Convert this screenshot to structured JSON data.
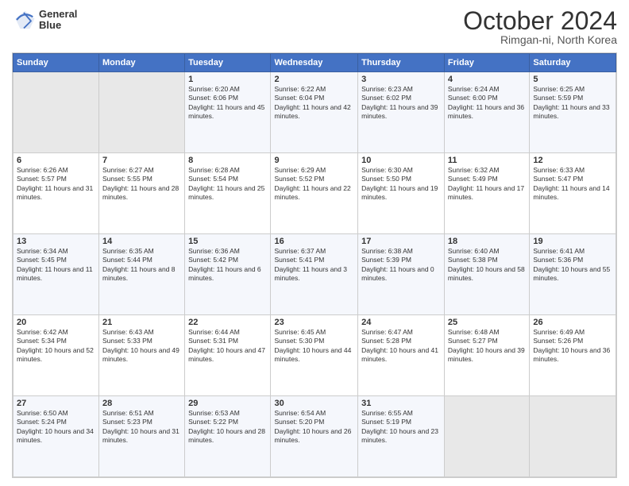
{
  "header": {
    "logo": {
      "line1": "General",
      "line2": "Blue"
    },
    "title": "October 2024",
    "subtitle": "Rimgan-ni, North Korea"
  },
  "weekdays": [
    "Sunday",
    "Monday",
    "Tuesday",
    "Wednesday",
    "Thursday",
    "Friday",
    "Saturday"
  ],
  "weeks": [
    [
      {
        "day": null,
        "sunrise": null,
        "sunset": null,
        "daylight": null
      },
      {
        "day": null,
        "sunrise": null,
        "sunset": null,
        "daylight": null
      },
      {
        "day": "1",
        "sunrise": "Sunrise: 6:20 AM",
        "sunset": "Sunset: 6:06 PM",
        "daylight": "Daylight: 11 hours and 45 minutes."
      },
      {
        "day": "2",
        "sunrise": "Sunrise: 6:22 AM",
        "sunset": "Sunset: 6:04 PM",
        "daylight": "Daylight: 11 hours and 42 minutes."
      },
      {
        "day": "3",
        "sunrise": "Sunrise: 6:23 AM",
        "sunset": "Sunset: 6:02 PM",
        "daylight": "Daylight: 11 hours and 39 minutes."
      },
      {
        "day": "4",
        "sunrise": "Sunrise: 6:24 AM",
        "sunset": "Sunset: 6:00 PM",
        "daylight": "Daylight: 11 hours and 36 minutes."
      },
      {
        "day": "5",
        "sunrise": "Sunrise: 6:25 AM",
        "sunset": "Sunset: 5:59 PM",
        "daylight": "Daylight: 11 hours and 33 minutes."
      }
    ],
    [
      {
        "day": "6",
        "sunrise": "Sunrise: 6:26 AM",
        "sunset": "Sunset: 5:57 PM",
        "daylight": "Daylight: 11 hours and 31 minutes."
      },
      {
        "day": "7",
        "sunrise": "Sunrise: 6:27 AM",
        "sunset": "Sunset: 5:55 PM",
        "daylight": "Daylight: 11 hours and 28 minutes."
      },
      {
        "day": "8",
        "sunrise": "Sunrise: 6:28 AM",
        "sunset": "Sunset: 5:54 PM",
        "daylight": "Daylight: 11 hours and 25 minutes."
      },
      {
        "day": "9",
        "sunrise": "Sunrise: 6:29 AM",
        "sunset": "Sunset: 5:52 PM",
        "daylight": "Daylight: 11 hours and 22 minutes."
      },
      {
        "day": "10",
        "sunrise": "Sunrise: 6:30 AM",
        "sunset": "Sunset: 5:50 PM",
        "daylight": "Daylight: 11 hours and 19 minutes."
      },
      {
        "day": "11",
        "sunrise": "Sunrise: 6:32 AM",
        "sunset": "Sunset: 5:49 PM",
        "daylight": "Daylight: 11 hours and 17 minutes."
      },
      {
        "day": "12",
        "sunrise": "Sunrise: 6:33 AM",
        "sunset": "Sunset: 5:47 PM",
        "daylight": "Daylight: 11 hours and 14 minutes."
      }
    ],
    [
      {
        "day": "13",
        "sunrise": "Sunrise: 6:34 AM",
        "sunset": "Sunset: 5:45 PM",
        "daylight": "Daylight: 11 hours and 11 minutes."
      },
      {
        "day": "14",
        "sunrise": "Sunrise: 6:35 AM",
        "sunset": "Sunset: 5:44 PM",
        "daylight": "Daylight: 11 hours and 8 minutes."
      },
      {
        "day": "15",
        "sunrise": "Sunrise: 6:36 AM",
        "sunset": "Sunset: 5:42 PM",
        "daylight": "Daylight: 11 hours and 6 minutes."
      },
      {
        "day": "16",
        "sunrise": "Sunrise: 6:37 AM",
        "sunset": "Sunset: 5:41 PM",
        "daylight": "Daylight: 11 hours and 3 minutes."
      },
      {
        "day": "17",
        "sunrise": "Sunrise: 6:38 AM",
        "sunset": "Sunset: 5:39 PM",
        "daylight": "Daylight: 11 hours and 0 minutes."
      },
      {
        "day": "18",
        "sunrise": "Sunrise: 6:40 AM",
        "sunset": "Sunset: 5:38 PM",
        "daylight": "Daylight: 10 hours and 58 minutes."
      },
      {
        "day": "19",
        "sunrise": "Sunrise: 6:41 AM",
        "sunset": "Sunset: 5:36 PM",
        "daylight": "Daylight: 10 hours and 55 minutes."
      }
    ],
    [
      {
        "day": "20",
        "sunrise": "Sunrise: 6:42 AM",
        "sunset": "Sunset: 5:34 PM",
        "daylight": "Daylight: 10 hours and 52 minutes."
      },
      {
        "day": "21",
        "sunrise": "Sunrise: 6:43 AM",
        "sunset": "Sunset: 5:33 PM",
        "daylight": "Daylight: 10 hours and 49 minutes."
      },
      {
        "day": "22",
        "sunrise": "Sunrise: 6:44 AM",
        "sunset": "Sunset: 5:31 PM",
        "daylight": "Daylight: 10 hours and 47 minutes."
      },
      {
        "day": "23",
        "sunrise": "Sunrise: 6:45 AM",
        "sunset": "Sunset: 5:30 PM",
        "daylight": "Daylight: 10 hours and 44 minutes."
      },
      {
        "day": "24",
        "sunrise": "Sunrise: 6:47 AM",
        "sunset": "Sunset: 5:28 PM",
        "daylight": "Daylight: 10 hours and 41 minutes."
      },
      {
        "day": "25",
        "sunrise": "Sunrise: 6:48 AM",
        "sunset": "Sunset: 5:27 PM",
        "daylight": "Daylight: 10 hours and 39 minutes."
      },
      {
        "day": "26",
        "sunrise": "Sunrise: 6:49 AM",
        "sunset": "Sunset: 5:26 PM",
        "daylight": "Daylight: 10 hours and 36 minutes."
      }
    ],
    [
      {
        "day": "27",
        "sunrise": "Sunrise: 6:50 AM",
        "sunset": "Sunset: 5:24 PM",
        "daylight": "Daylight: 10 hours and 34 minutes."
      },
      {
        "day": "28",
        "sunrise": "Sunrise: 6:51 AM",
        "sunset": "Sunset: 5:23 PM",
        "daylight": "Daylight: 10 hours and 31 minutes."
      },
      {
        "day": "29",
        "sunrise": "Sunrise: 6:53 AM",
        "sunset": "Sunset: 5:22 PM",
        "daylight": "Daylight: 10 hours and 28 minutes."
      },
      {
        "day": "30",
        "sunrise": "Sunrise: 6:54 AM",
        "sunset": "Sunset: 5:20 PM",
        "daylight": "Daylight: 10 hours and 26 minutes."
      },
      {
        "day": "31",
        "sunrise": "Sunrise: 6:55 AM",
        "sunset": "Sunset: 5:19 PM",
        "daylight": "Daylight: 10 hours and 23 minutes."
      },
      {
        "day": null,
        "sunrise": null,
        "sunset": null,
        "daylight": null
      },
      {
        "day": null,
        "sunrise": null,
        "sunset": null,
        "daylight": null
      }
    ]
  ]
}
